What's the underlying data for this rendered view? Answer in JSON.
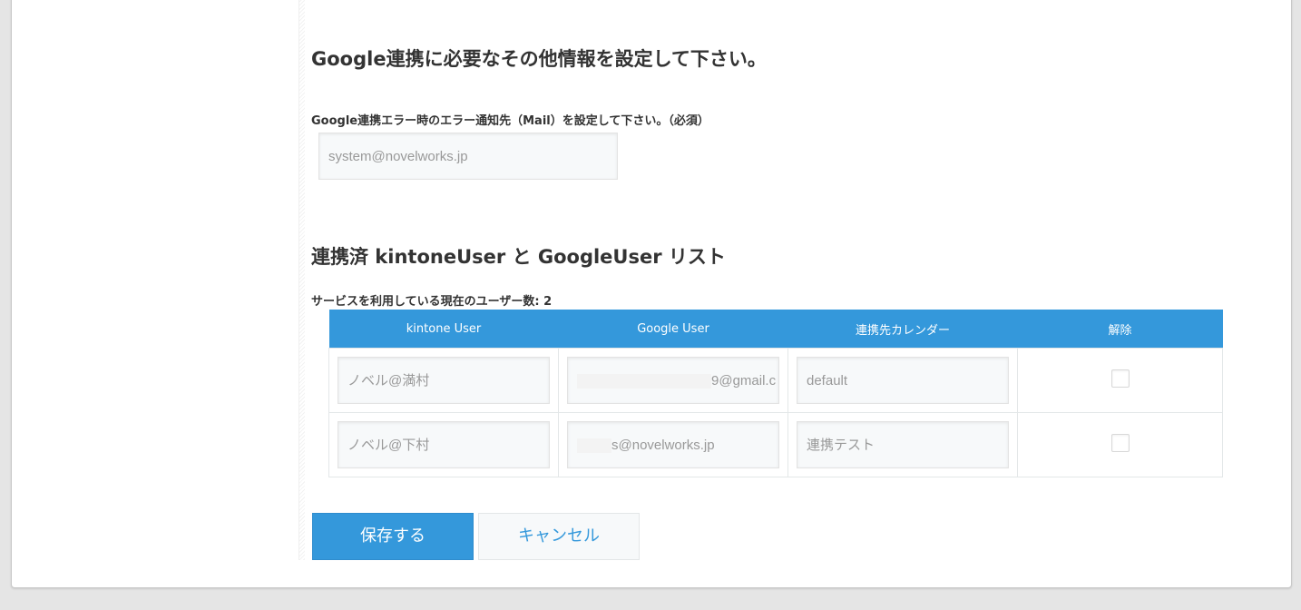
{
  "settings": {
    "heading": "Google連携に必要なその他情報を設定して下さい。",
    "mail_label": "Google連携エラー時のエラー通知先（Mail）を設定して下さい。（必須）",
    "mail_value": "system@novelworks.jp"
  },
  "user_list": {
    "heading": "連携済 kintoneUser と GoogleUser リスト",
    "count_label": "サービスを利用している現在のユーザー数: 2",
    "columns": [
      "kintone User",
      "Google User",
      "連携先カレンダー",
      "解除"
    ],
    "rows": [
      {
        "kintone_user": "ノベル@満村",
        "google_user": "9@gmail.c",
        "calendar": "default",
        "unlink_checked": false
      },
      {
        "kintone_user": "ノベル@下村",
        "google_user": "s@novelworks.jp",
        "calendar": "連携テスト",
        "unlink_checked": false
      }
    ]
  },
  "buttons": {
    "save": "保存する",
    "cancel": "キャンセル"
  },
  "colors": {
    "accent": "#3498db",
    "background": "#e5e5e5",
    "panel": "#ffffff"
  }
}
